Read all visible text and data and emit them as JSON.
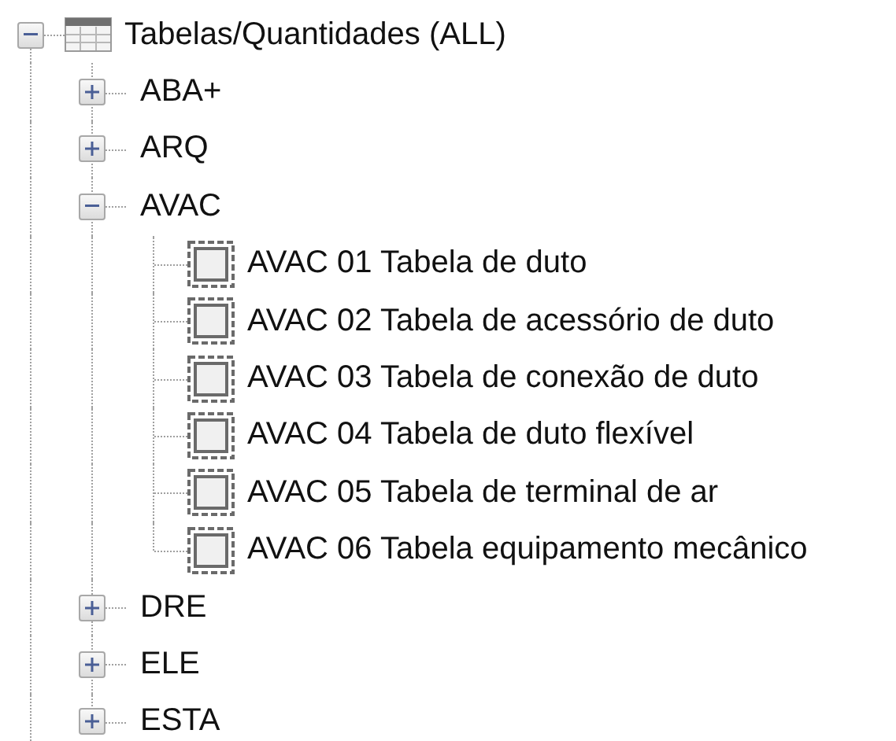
{
  "tree": [
    {
      "label": "Tabelas/Quantidades (ALL)",
      "kind": "tables",
      "expanded": true,
      "children": [
        {
          "label": "ABA+",
          "kind": "group",
          "expanded": false
        },
        {
          "label": "ARQ",
          "kind": "group",
          "expanded": false
        },
        {
          "label": "AVAC",
          "kind": "group",
          "expanded": true,
          "children": [
            {
              "label": "AVAC 01 Tabela de duto",
              "kind": "schedule"
            },
            {
              "label": "AVAC 02 Tabela de acessório de duto",
              "kind": "schedule"
            },
            {
              "label": "AVAC 03 Tabela de conexão de duto",
              "kind": "schedule"
            },
            {
              "label": "AVAC 04 Tabela de duto flexível",
              "kind": "schedule"
            },
            {
              "label": "AVAC 05 Tabela de terminal de ar",
              "kind": "schedule"
            },
            {
              "label": "AVAC 06 Tabela equipamento mecânico",
              "kind": "schedule"
            }
          ]
        },
        {
          "label": "DRE",
          "kind": "group",
          "expanded": false
        },
        {
          "label": "ELE",
          "kind": "group",
          "expanded": false
        },
        {
          "label": "ESTA",
          "kind": "group",
          "expanded": false
        }
      ]
    }
  ]
}
